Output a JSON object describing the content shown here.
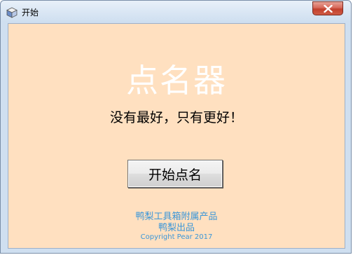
{
  "window": {
    "title": "开始",
    "icon": "app-cube-icon",
    "close_icon": "close-icon",
    "colors": {
      "client_background": "#ffe0c0",
      "heading": "#ffffff",
      "footer_text": "#3a96d8",
      "close_button": "#c9483a"
    }
  },
  "main": {
    "heading": "点名器",
    "slogan": "没有最好，只有更好！",
    "start_button_label": "开始点名"
  },
  "footer": {
    "line1": "鸭梨工具箱附属产品",
    "line2": "鸭梨出品",
    "copyright": "Copyright Pear 2017"
  }
}
